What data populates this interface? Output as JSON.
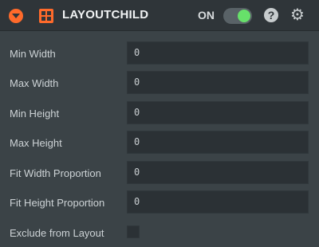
{
  "header": {
    "collapse_icon": "chevron-down-circle-icon",
    "component_icon": "grid-icon",
    "title": "LAYOUTCHILD",
    "toggle_label": "ON",
    "toggle_state": true,
    "help_icon": "help-icon",
    "settings_icon": "gear-icon",
    "accent_color": "#ff6a2b",
    "toggle_color": "#67e06a"
  },
  "fields": [
    {
      "label": "Min Width",
      "value": "0"
    },
    {
      "label": "Max Width",
      "value": "0"
    },
    {
      "label": "Min Height",
      "value": "0"
    },
    {
      "label": "Max Height",
      "value": "0"
    },
    {
      "label": "Fit Width Proportion",
      "value": "0"
    },
    {
      "label": "Fit Height Proportion",
      "value": "0"
    }
  ],
  "exclude": {
    "label": "Exclude from Layout",
    "checked": false
  }
}
